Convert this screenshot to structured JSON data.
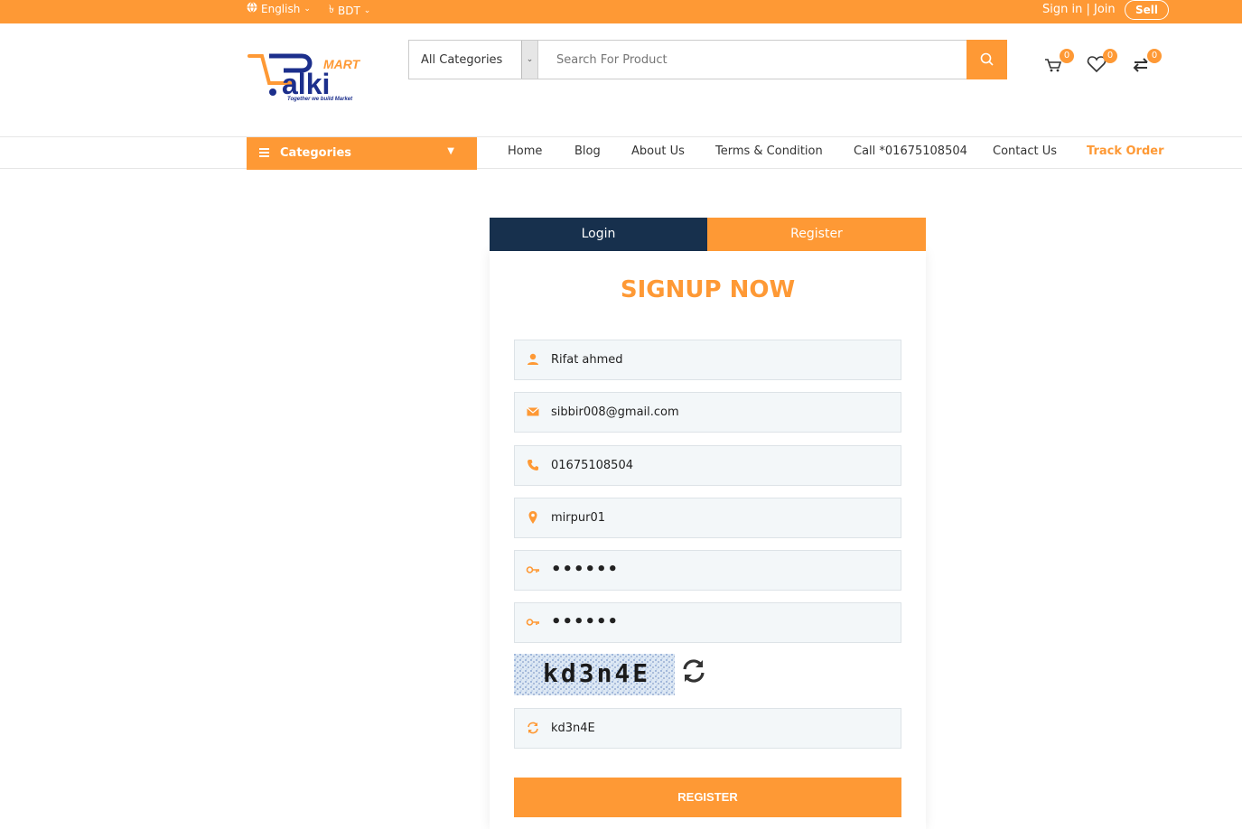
{
  "topbar": {
    "language": "English",
    "currency": "BDT",
    "sign_in": "Sign in",
    "separator": " | ",
    "join": "Join",
    "sell": "Sell"
  },
  "brand": {
    "logo_main": "alki",
    "logo_sub": "MART",
    "tagline": "Together we build Market",
    "accent_color": "#fe9935",
    "dark_color": "#17304d"
  },
  "header": {
    "category_select": "All Categories",
    "search_placeholder": "Search For Product",
    "cart_count": "0",
    "wishlist_count": "0",
    "compare_count": "0"
  },
  "nav": {
    "categories_label": "Categories",
    "links": [
      "Home",
      "Blog",
      "About Us",
      "Terms & Condition",
      "Call *01675108504",
      "Contact Us",
      "Track Order"
    ]
  },
  "auth": {
    "tab_login": "Login",
    "tab_register": "Register",
    "title": "SIGNUP NOW",
    "fields": {
      "name": "Rifat ahmed",
      "email": "sibbir008@gmail.com",
      "phone": "01675108504",
      "address": "mirpur01",
      "password": "••••••",
      "confirm_password": "••••••",
      "captcha_input": "kd3n4E"
    },
    "captcha_text": "kd3n4E",
    "register_button": "REGISTER"
  }
}
